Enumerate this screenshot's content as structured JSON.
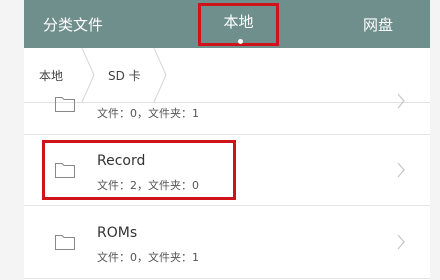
{
  "topbar": {
    "tab_categories": "分类文件",
    "tab_local": "本地",
    "tab_cloud": "网盘"
  },
  "breadcrumb": {
    "items": [
      "本地",
      "SD 卡"
    ]
  },
  "list": {
    "items": [
      {
        "name": "",
        "meta": "文件：0，文件夹：1"
      },
      {
        "name": "Record",
        "meta": "文件：2，文件夹：0"
      },
      {
        "name": "ROMs",
        "meta": "文件：0，文件夹：1"
      }
    ]
  },
  "colors": {
    "topbar": "#6f8f8d",
    "highlight": "#d0121b"
  }
}
